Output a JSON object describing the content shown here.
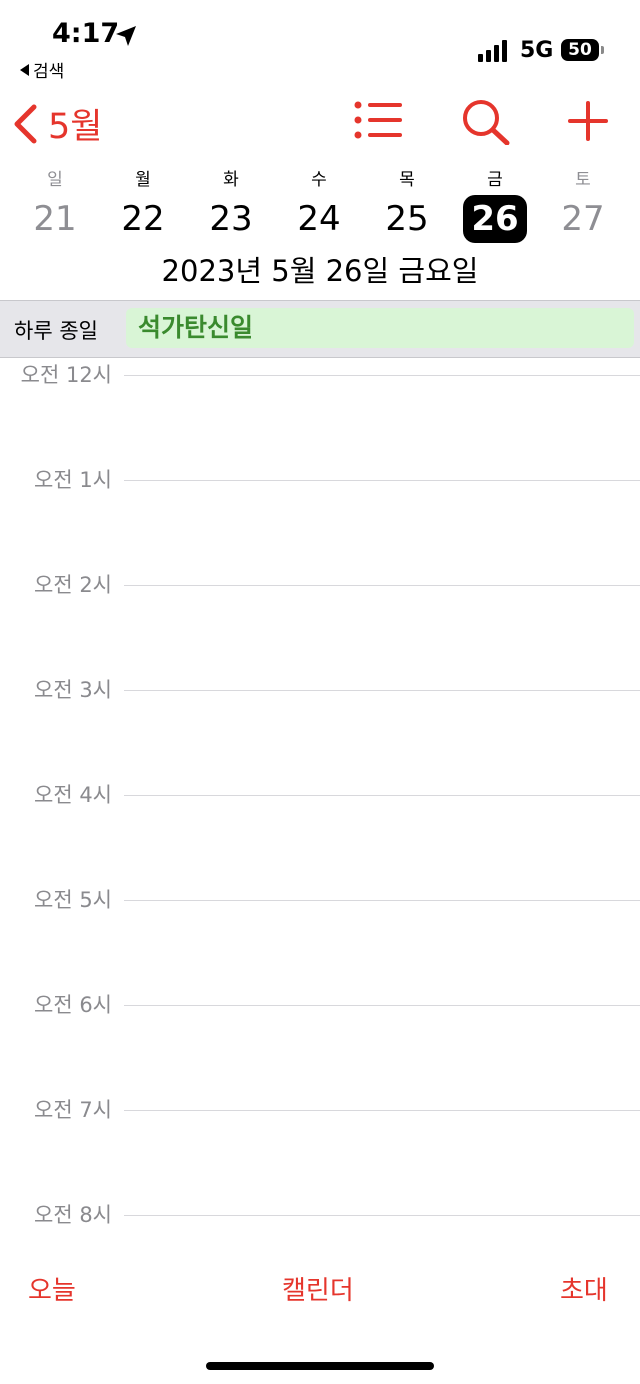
{
  "status_bar": {
    "time": "4:17",
    "back_label": "검색",
    "network": "5G",
    "battery": "50"
  },
  "nav": {
    "month_label": "5월",
    "accent_color": "#e5352c"
  },
  "week": {
    "weekdays": [
      "일",
      "월",
      "화",
      "수",
      "목",
      "금",
      "토"
    ],
    "days": [
      "21",
      "22",
      "23",
      "24",
      "25",
      "26",
      "27"
    ],
    "selected_index": 5
  },
  "full_date": "2023년 5월 26일 금요일",
  "all_day": {
    "label": "하루 종일",
    "event": "석가탄신일"
  },
  "hours": [
    "오전 12시",
    "오전 1시",
    "오전 2시",
    "오전 3시",
    "오전 4시",
    "오전 5시",
    "오전 6시",
    "오전 7시",
    "오전 8시"
  ],
  "tab_bar": {
    "today": "오늘",
    "calendars": "캘린더",
    "inbox": "초대"
  }
}
